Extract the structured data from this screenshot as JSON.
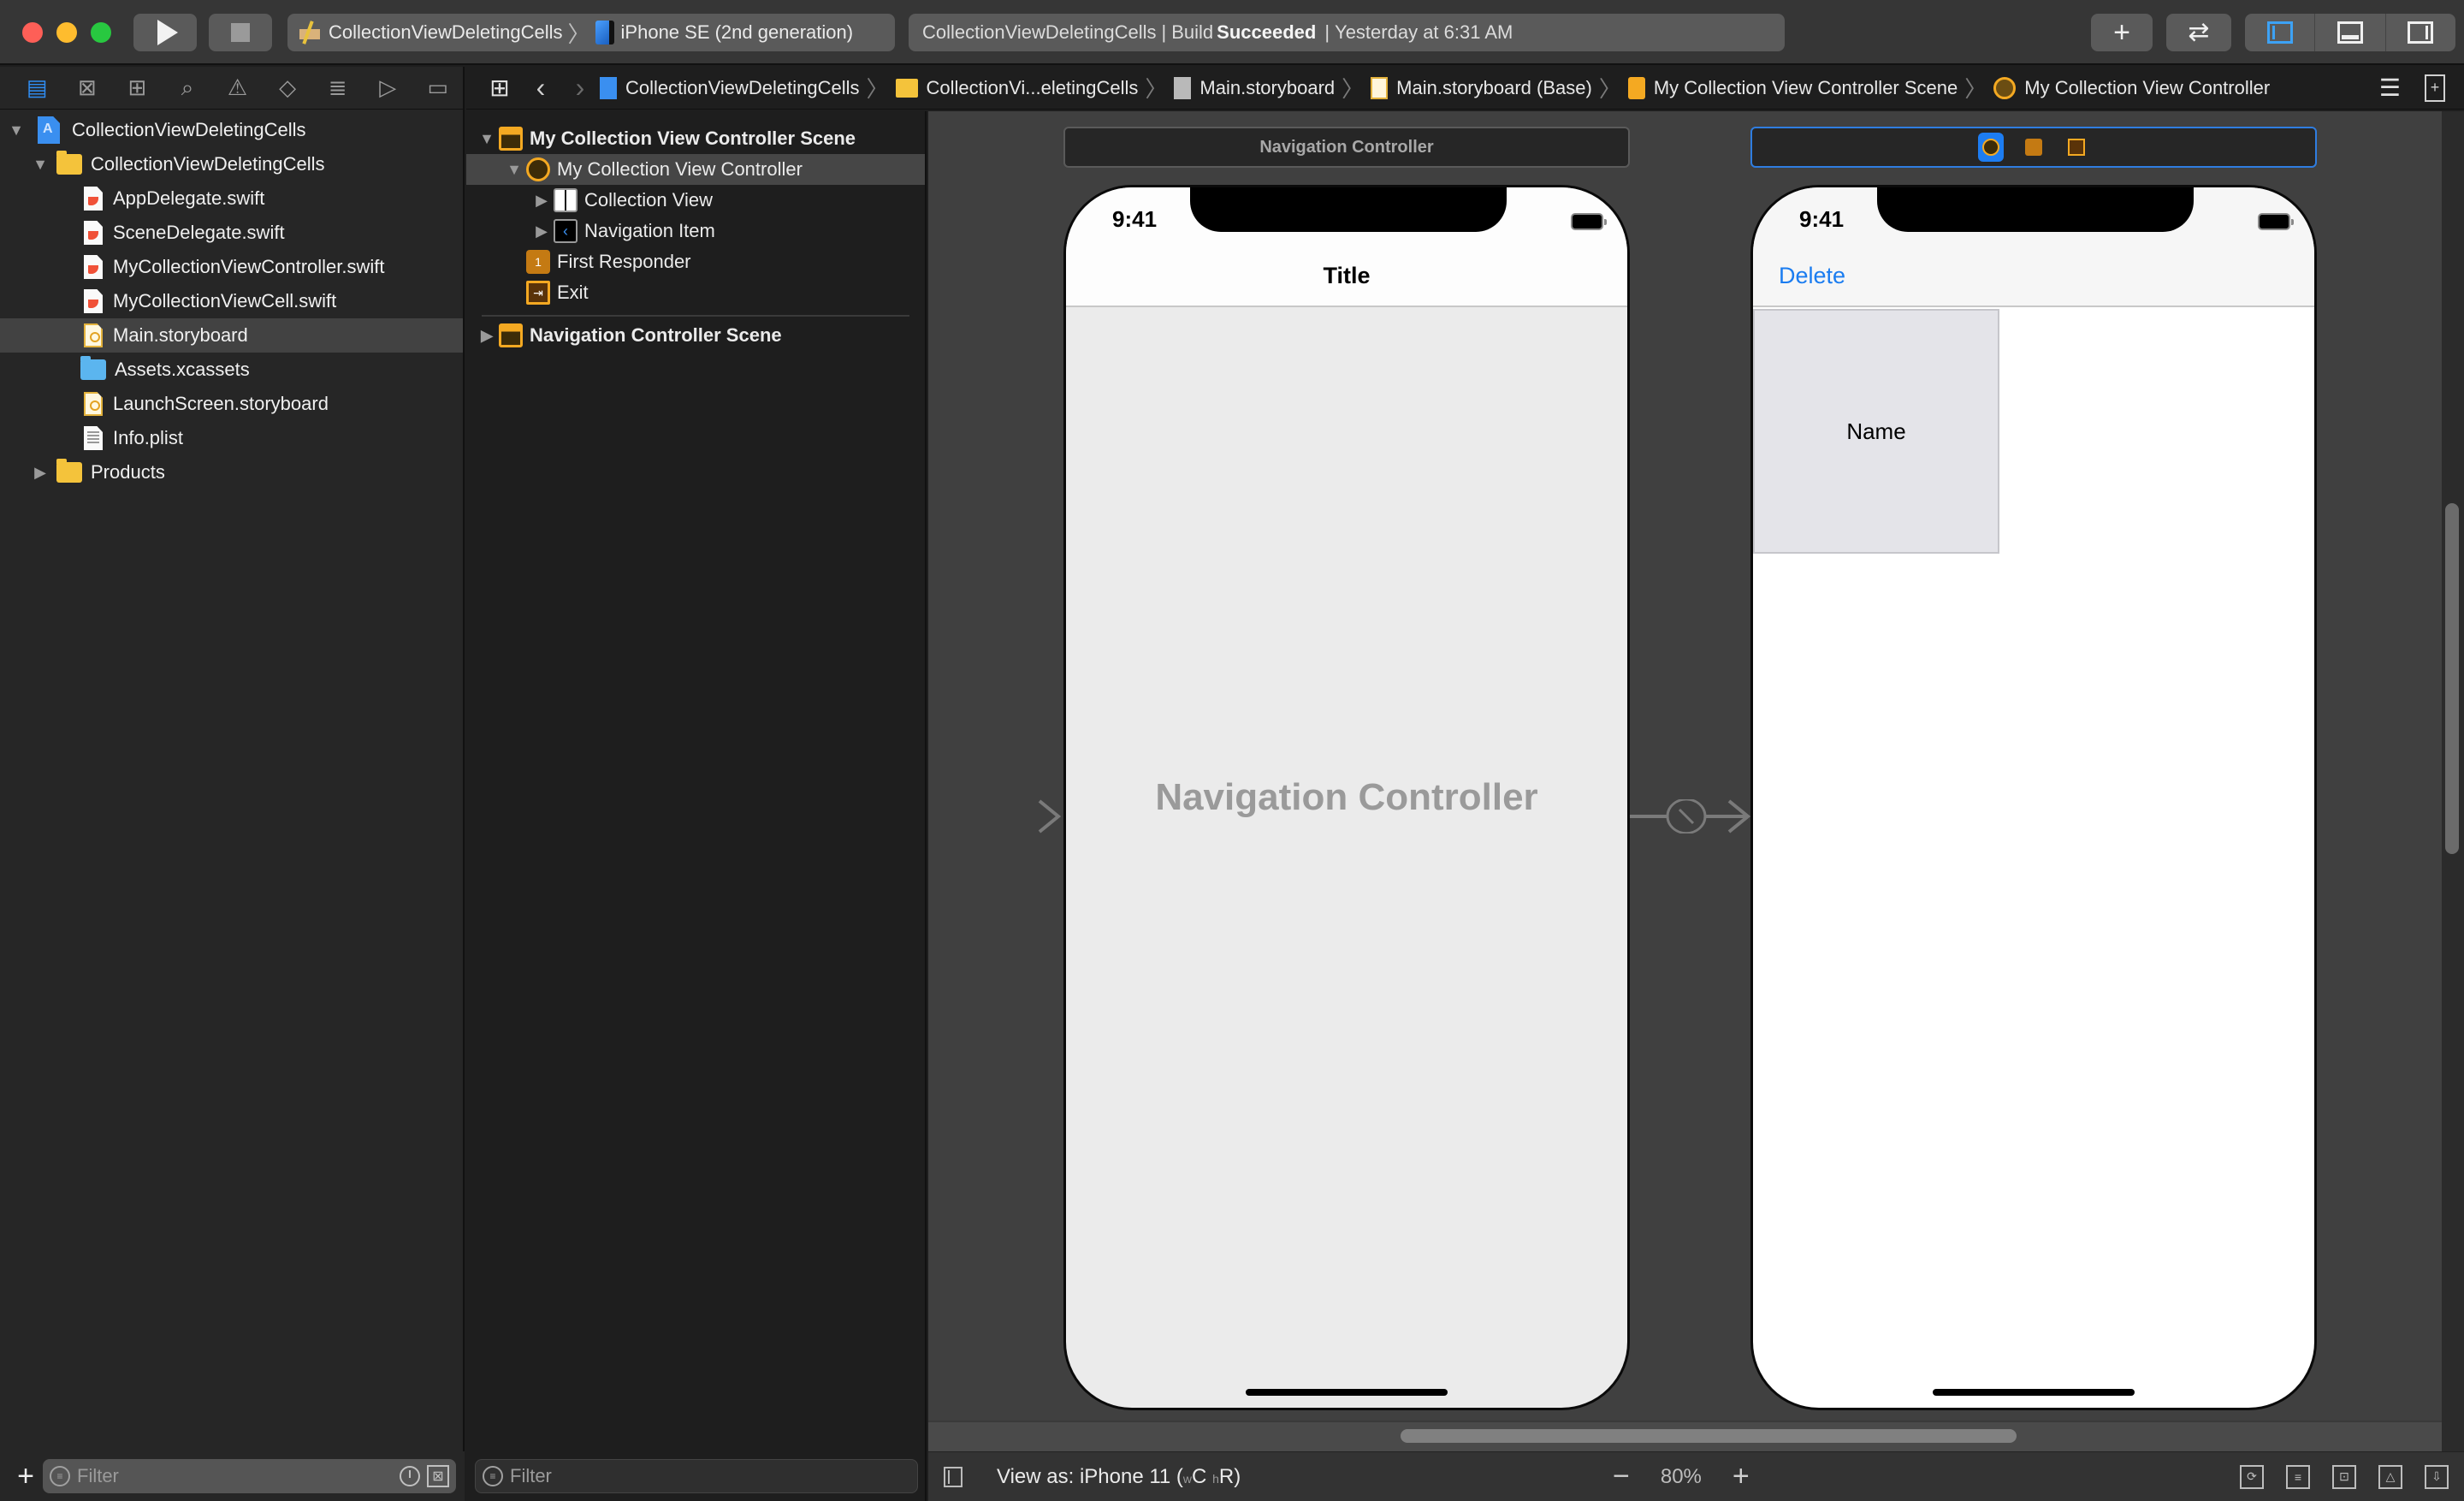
{
  "titlebar": {
    "scheme_name": "CollectionViewDeletingCells",
    "scheme_separator": "〉",
    "destination": "iPhone SE (2nd generation)",
    "activity_project": "CollectionViewDeletingCells",
    "activity_divider": "|",
    "activity_build_prefix": "Build",
    "activity_build_status": "Succeeded",
    "activity_time": "Yesterday at 6:31 AM",
    "run_label": "Run",
    "stop_label": "Stop",
    "library_glyph": "+",
    "review_glyph": "⇄"
  },
  "navigator": {
    "tabs": [
      {
        "name": "project-navigator",
        "glyph": "▤"
      },
      {
        "name": "source-control-navigator",
        "glyph": "⊠"
      },
      {
        "name": "symbol-navigator",
        "glyph": "⊞"
      },
      {
        "name": "find-navigator",
        "glyph": "⌕"
      },
      {
        "name": "issue-navigator",
        "glyph": "⚠"
      },
      {
        "name": "test-navigator",
        "glyph": "◇"
      },
      {
        "name": "debug-navigator",
        "glyph": "≣"
      },
      {
        "name": "breakpoint-navigator",
        "glyph": "▷"
      },
      {
        "name": "report-navigator",
        "glyph": "▭"
      }
    ],
    "tree": [
      {
        "label": "CollectionViewDeletingCells",
        "type": "project",
        "level": 0,
        "expanded": true
      },
      {
        "label": "CollectionViewDeletingCells",
        "type": "folder",
        "level": 1,
        "expanded": true
      },
      {
        "label": "AppDelegate.swift",
        "type": "swift",
        "level": 2
      },
      {
        "label": "SceneDelegate.swift",
        "type": "swift",
        "level": 2
      },
      {
        "label": "MyCollectionViewController.swift",
        "type": "swift",
        "level": 2
      },
      {
        "label": "MyCollectionViewCell.swift",
        "type": "swift",
        "level": 2
      },
      {
        "label": "Main.storyboard",
        "type": "storyboard",
        "level": 2,
        "selected": true
      },
      {
        "label": "Assets.xcassets",
        "type": "assets",
        "level": 2
      },
      {
        "label": "LaunchScreen.storyboard",
        "type": "storyboard",
        "level": 2
      },
      {
        "label": "Info.plist",
        "type": "plist",
        "level": 2
      },
      {
        "label": "Products",
        "type": "folder",
        "level": 1,
        "expanded": false
      }
    ],
    "filter_placeholder": "Filter",
    "add_glyph": "+"
  },
  "jumpbar": {
    "related_glyph": "⊞",
    "back_glyph": "‹",
    "forward_glyph": "›",
    "separator": "〉",
    "crumbs": [
      {
        "label": "CollectionViewDeletingCells",
        "icon": "project"
      },
      {
        "label": "CollectionVi...eletingCells",
        "icon": "folder"
      },
      {
        "label": "Main.storyboard",
        "icon": "storyboard-grey"
      },
      {
        "label": "Main.storyboard (Base)",
        "icon": "storyboard"
      },
      {
        "label": "My Collection View Controller Scene",
        "icon": "scene"
      },
      {
        "label": "My Collection View Controller",
        "icon": "view-controller"
      }
    ],
    "options_glyph": "☰",
    "add_editor_glyph": "+"
  },
  "outline": {
    "rows": [
      {
        "label": "My Collection View Controller Scene",
        "icon": "scene",
        "indent": 0,
        "disclosure": "▼",
        "bold": true
      },
      {
        "label": "My Collection View Controller",
        "icon": "view-controller",
        "indent": 1,
        "disclosure": "▼",
        "selected": true
      },
      {
        "label": "Collection View",
        "icon": "collection-view",
        "indent": 2,
        "disclosure": "▶"
      },
      {
        "label": "Navigation Item",
        "icon": "navigation-item",
        "indent": 2,
        "disclosure": "▶"
      },
      {
        "label": "First Responder",
        "icon": "first-responder",
        "indent": 1,
        "disclosure": ""
      },
      {
        "label": "Exit",
        "icon": "exit",
        "indent": 1,
        "disclosure": ""
      }
    ],
    "second_scene": {
      "label": "Navigation Controller Scene",
      "icon": "scene",
      "disclosure": "▶"
    },
    "filter_placeholder": "Filter",
    "navitem_glyph": "‹",
    "first_responder_glyph": "1",
    "exit_glyph": "⇥"
  },
  "canvas": {
    "nav_scene_dock_label": "Navigation Controller",
    "nav_phone": {
      "time": "9:41",
      "title": "Title",
      "placeholder": "Navigation Controller"
    },
    "cvc_phone": {
      "time": "9:41",
      "left_bar_button": "Delete",
      "cell_label": "Name"
    },
    "accent_color": "#1a7cf0"
  },
  "bottombar": {
    "view_as_prefix": "View as: iPhone 11 (",
    "width_class_marker": "w",
    "width_class": "C",
    "height_class_marker": "h",
    "height_class": "R",
    "view_as_suffix": ")",
    "zoom_out_glyph": "−",
    "zoom_level": "80%",
    "zoom_in_glyph": "+"
  }
}
